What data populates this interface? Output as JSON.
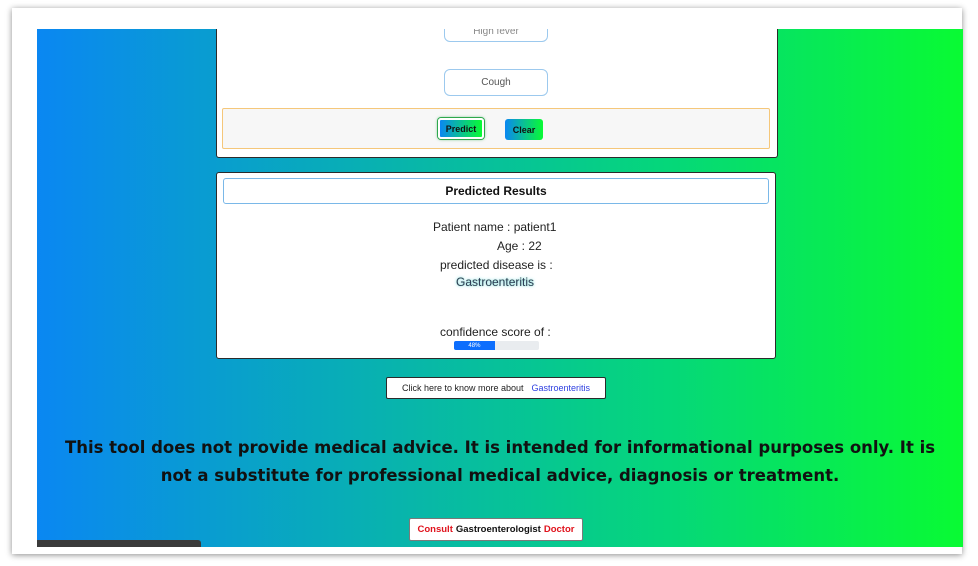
{
  "form": {
    "symptoms": [
      "High fever",
      "Cough"
    ],
    "predict_label": "Predict",
    "clear_label": "Clear"
  },
  "results": {
    "title": "Predicted Results",
    "patient_line": "Patient name : patient1",
    "age_line": "Age : 22",
    "predicted_label": "predicted disease is :",
    "disease": "Gastroenteritis",
    "confidence_label": "confidence score of :",
    "confidence_text": "48%",
    "confidence_value": 48
  },
  "know_more": {
    "prefix": "Click here to know more about",
    "link": "Gastroenteritis"
  },
  "disclaimer": "This tool does not provide medical advice. It is intended for informational purposes only. It is not a substitute for professional medical advice, diagnosis or treatment.",
  "consult": {
    "prefix": "Consult",
    "specialist": "Gastroenterologist",
    "suffix": "Doctor"
  },
  "colors": {
    "gradient_start": "#0a87f2",
    "gradient_end": "#09fb33",
    "progress": "#0d6efd",
    "link": "#2d3fe0",
    "consult_red": "#e0121c"
  }
}
